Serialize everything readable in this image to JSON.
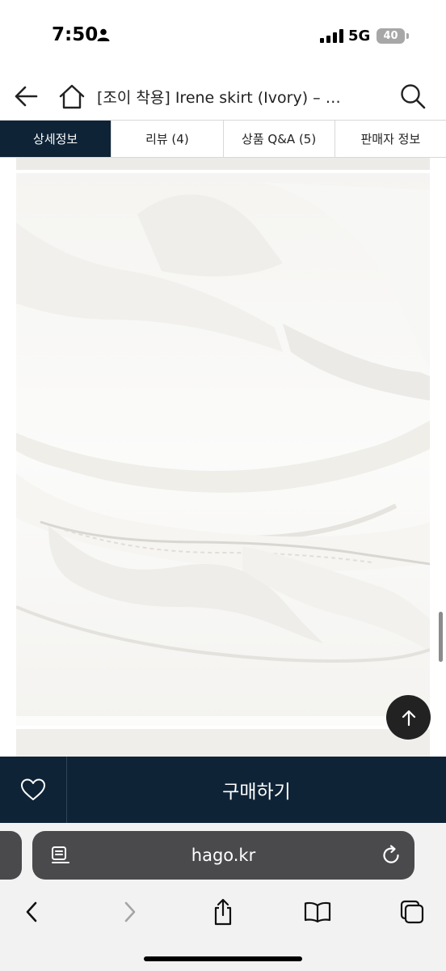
{
  "status": {
    "time": "7:50",
    "network": "5G",
    "battery": "40"
  },
  "header": {
    "title": "[조이 착용] Irene skirt (Ivory) – …",
    "icons": [
      "back-arrow-icon",
      "home-icon",
      "search-icon"
    ]
  },
  "tabs": [
    {
      "label": "상세정보",
      "active": true
    },
    {
      "label": "리뷰 (4)",
      "active": false
    },
    {
      "label": "상품 Q&A (5)",
      "active": false
    },
    {
      "label": "판매자 정보",
      "active": false
    }
  ],
  "purchase": {
    "label": "구매하기",
    "wishlist_icon": "heart-outline-icon"
  },
  "browser": {
    "url": "hago.kr",
    "toolbar_icons": [
      "back-icon",
      "forward-icon",
      "share-icon",
      "bookmarks-icon",
      "tabs-icon"
    ]
  },
  "colors": {
    "navy": "#0e2336",
    "browser_pill": "#4a4a4c"
  }
}
